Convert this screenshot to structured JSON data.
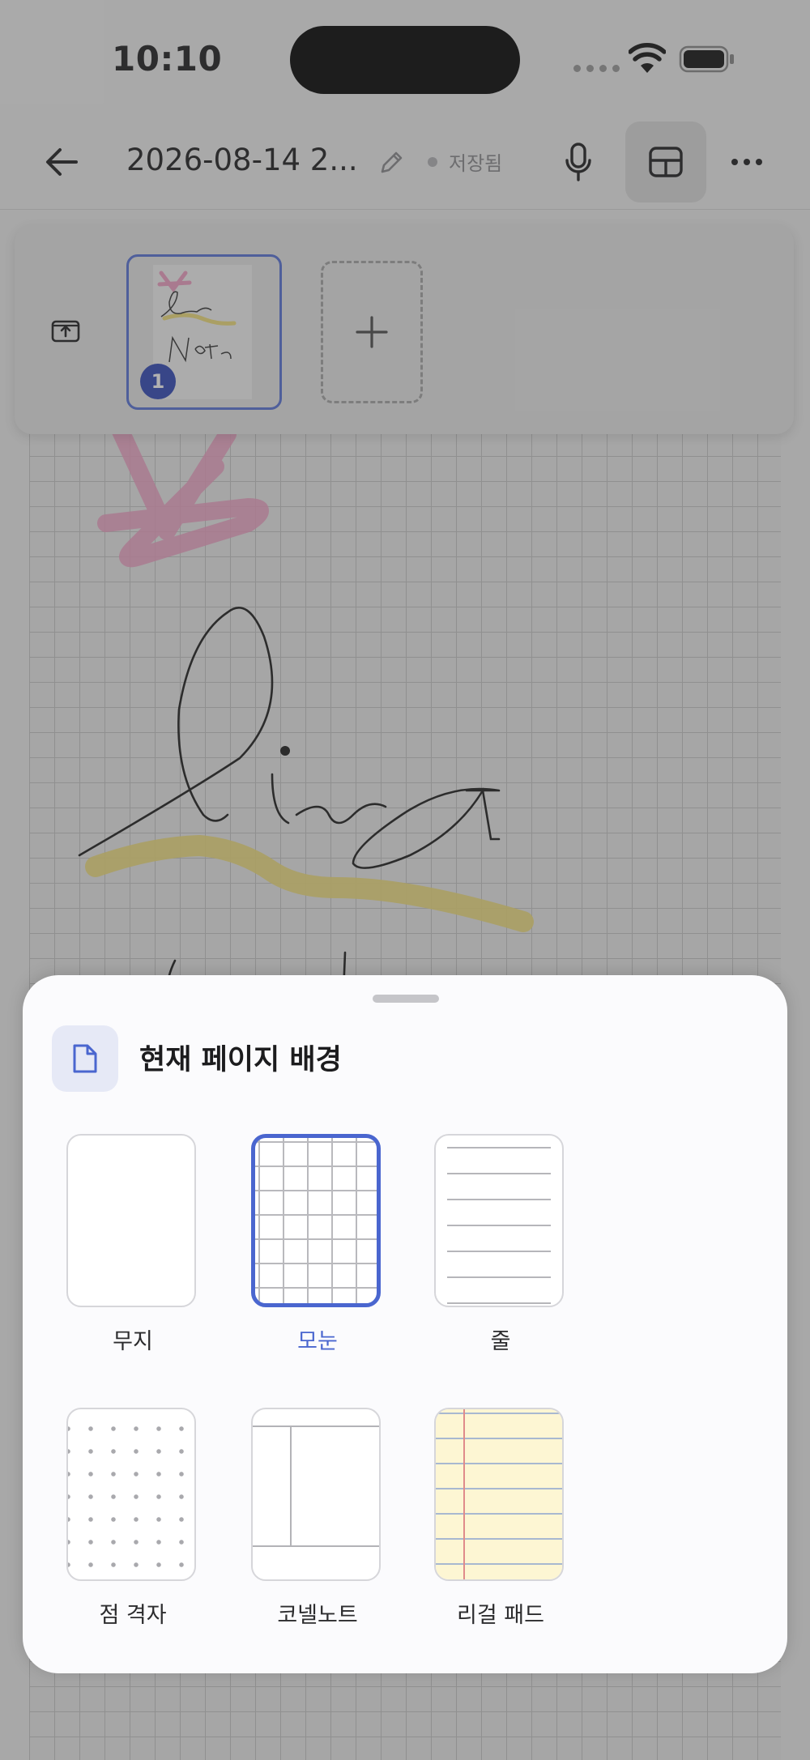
{
  "status_bar": {
    "time": "10:10"
  },
  "nav": {
    "title": "2026-08-14 2...",
    "save_status": "저장됨"
  },
  "page_strip": {
    "pages": [
      {
        "number": "1",
        "selected": true
      }
    ]
  },
  "sheet": {
    "title": "현재 페이지 배경",
    "options": [
      {
        "id": "blank",
        "label": "무지",
        "selected": false
      },
      {
        "id": "grid",
        "label": "모눈",
        "selected": true
      },
      {
        "id": "lined",
        "label": "줄",
        "selected": false
      },
      {
        "id": "dot",
        "label": "점 격자",
        "selected": false
      },
      {
        "id": "cornell",
        "label": "코넬노트",
        "selected": false
      },
      {
        "id": "legal",
        "label": "리걸 패드",
        "selected": false
      }
    ]
  },
  "colors": {
    "accent": "#4a66cf",
    "badge": "#2f47b8",
    "highlighter_pink": "#f2a0c4",
    "highlighter_yellow": "#f3e07a",
    "ink": "#1a1a1a"
  }
}
